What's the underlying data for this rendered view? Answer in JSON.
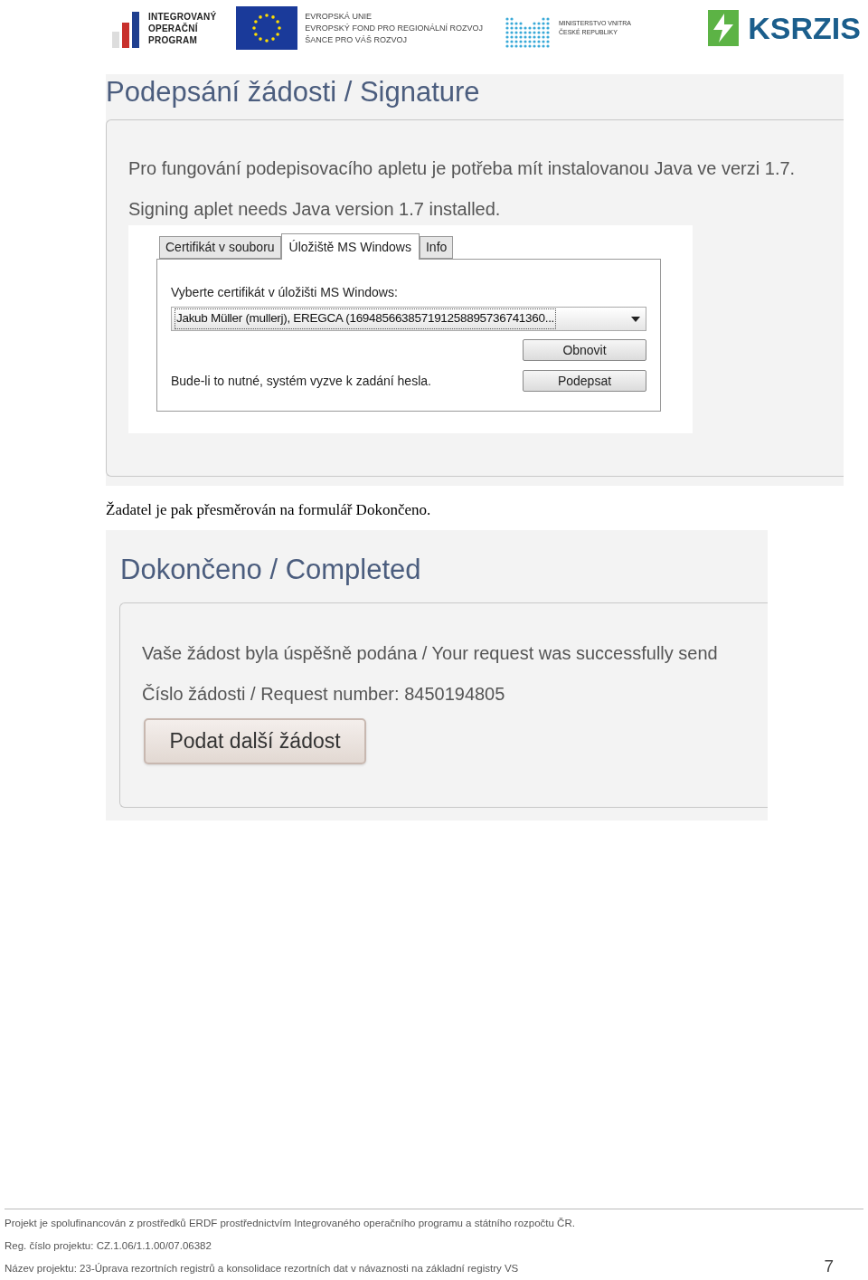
{
  "header": {
    "logos": [
      {
        "kind": "iop",
        "lines": [
          "INTEGROVANÝ",
          "OPERAČNÍ",
          "PROGRAM"
        ]
      },
      {
        "kind": "eu",
        "lines": [
          "EVROPSKÁ UNIE",
          "EVROPSKÝ FOND PRO REGIONÁLNÍ ROZVOJ",
          "ŠANCE PRO VÁŠ ROZVOJ"
        ]
      },
      {
        "kind": "mvcr",
        "lines": [
          "MINISTERSTVO VNITRA",
          "ČESKÉ REPUBLIKY"
        ]
      },
      {
        "kind": "ksrzis",
        "lines": [
          "KSRZIS"
        ]
      }
    ]
  },
  "signature": {
    "title": "Podepsání žádosti / Signature",
    "messages": [
      "Pro fungování podepisovacího apletu je potřeba mít instalovanou Java ve verzi 1.7.",
      "Signing aplet needs Java version 1.7 installed."
    ],
    "applet": {
      "tabs": [
        {
          "label": "Certifikát v souboru",
          "selected": false
        },
        {
          "label": "Úložiště MS Windows",
          "selected": true
        },
        {
          "label": "Info",
          "selected": false
        }
      ],
      "select_label": "Vyberte certifikát v úložišti MS Windows:",
      "certificate": "Jakub Müller (mullerj), EREGCA (169485663857191258895736741360...",
      "note": "Bude-li to nutné, systém vyzve k zadání hesla.",
      "buttons": [
        "Obnovit",
        "Podepsat"
      ]
    }
  },
  "caption": "Žadatel je pak přesměrován na formulář Dokončeno.",
  "completed": {
    "title": "Dokončeno / Completed",
    "messages": [
      "Vaše žádost byla úspěšně podána / Your request was successfully send",
      "Číslo žádosti / Request number: 8450194805"
    ],
    "button": "Podat další žádost"
  },
  "footer": {
    "lines": [
      "Projekt je spolufinancován z prostředků ERDF prostřednictvím Integrovaného operačního programu a státního rozpočtu ČR.",
      "Reg. číslo projektu: CZ.1.06/1.1.00/07.06382",
      "Název projektu: 23-Úprava rezortních registrů a konsolidace rezortních dat v návaznosti na základní registry VS"
    ],
    "page_number": "7"
  }
}
